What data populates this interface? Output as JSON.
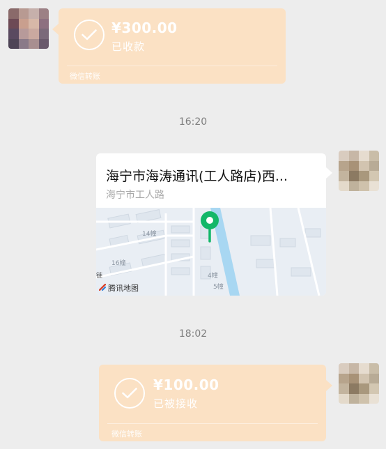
{
  "messages": {
    "transfer_received": {
      "amount": "¥300.00",
      "status": "已收款",
      "footer": "微信转账"
    },
    "time_1": "16:20",
    "location": {
      "title": "海宁市海涛通讯(工人路店)西...",
      "address": "海宁市工人路",
      "map_labels": [
        "14幢",
        "16幢",
        "4幢",
        "5幢",
        "链"
      ],
      "attribution": "腾讯地图"
    },
    "time_2": "18:02",
    "transfer_sent": {
      "amount": "¥100.00",
      "status": "已被接收",
      "footer": "微信转账"
    }
  },
  "colors": {
    "background": "#ededed",
    "transfer_bubble": "#fbe1c4",
    "pin": "#13b769",
    "river": "#a8d7f2"
  },
  "icons": [
    "check-circle-icon",
    "map-pin-icon",
    "tencent-map-logo-icon"
  ]
}
